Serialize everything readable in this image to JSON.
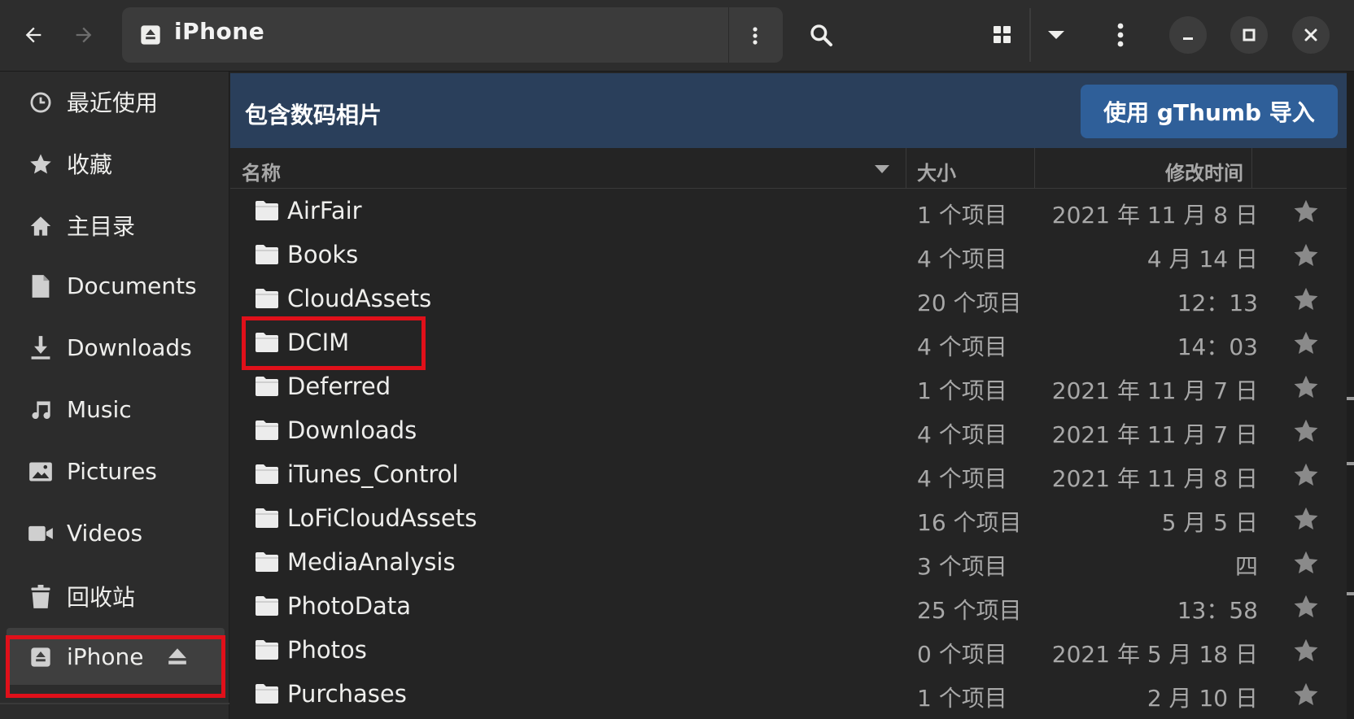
{
  "header": {
    "location_label": "iPhone"
  },
  "sidebar": {
    "items": [
      {
        "label": "最近使用",
        "icon": "clock-icon"
      },
      {
        "label": "收藏",
        "icon": "star-icon"
      },
      {
        "label": "主目录",
        "icon": "home-icon"
      },
      {
        "label": "Documents",
        "icon": "document-icon"
      },
      {
        "label": "Downloads",
        "icon": "download-icon"
      },
      {
        "label": "Music",
        "icon": "music-icon"
      },
      {
        "label": "Pictures",
        "icon": "picture-icon"
      },
      {
        "label": "Videos",
        "icon": "video-icon"
      },
      {
        "label": "回收站",
        "icon": "trash-icon"
      },
      {
        "label": "iPhone",
        "icon": "drive-icon",
        "selected": true
      }
    ]
  },
  "infobar": {
    "message": "包含数码相片",
    "button_label": "使用 gThumb 导入"
  },
  "columns": {
    "name": "名称",
    "size": "大小",
    "modified": "修改时间"
  },
  "files": [
    {
      "name": "AirFair",
      "size": "1 个项目",
      "modified": "2021 年 11 月 8 日"
    },
    {
      "name": "Books",
      "size": "4 个项目",
      "modified": "4 月 14 日"
    },
    {
      "name": "CloudAssets",
      "size": "20 个项目",
      "modified": "12：13"
    },
    {
      "name": "DCIM",
      "size": "4 个项目",
      "modified": "14：03"
    },
    {
      "name": "Deferred",
      "size": "1 个项目",
      "modified": "2021 年 11 月 7 日"
    },
    {
      "name": "Downloads",
      "size": "4 个项目",
      "modified": "2021 年 11 月 7 日"
    },
    {
      "name": "iTunes_Control",
      "size": "4 个项目",
      "modified": "2021 年 11 月 8 日"
    },
    {
      "name": "LoFiCloudAssets",
      "size": "16 个项目",
      "modified": "5 月 5 日"
    },
    {
      "name": "MediaAnalysis",
      "size": "3 个项目",
      "modified": "四"
    },
    {
      "name": "PhotoData",
      "size": "25 个项目",
      "modified": "13：58"
    },
    {
      "name": "Photos",
      "size": "0 个项目",
      "modified": "2021 年 5 月 18 日"
    },
    {
      "name": "Purchases",
      "size": "1 个项目",
      "modified": "2 月 10 日"
    }
  ],
  "colors": {
    "highlight": "#e0101a",
    "infobar_bg": "#2a3f5b",
    "infobar_button": "#2f5f99"
  }
}
